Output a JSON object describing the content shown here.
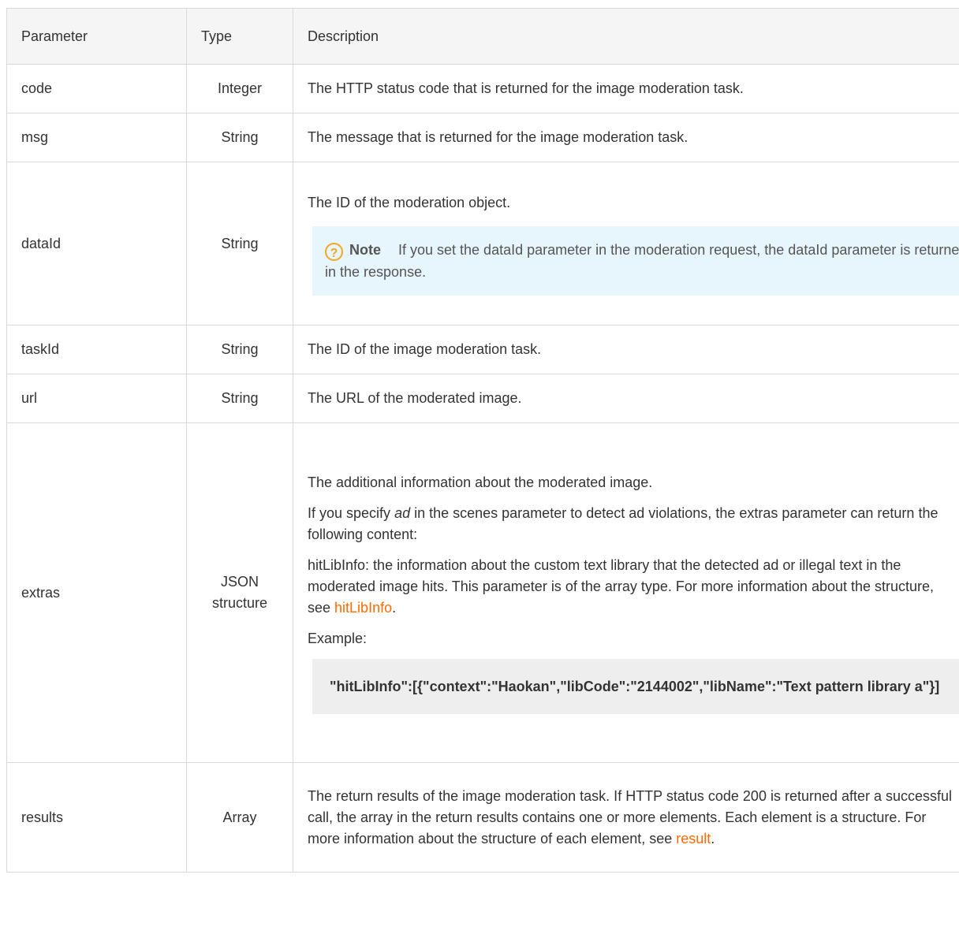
{
  "headers": [
    "Parameter",
    "Type",
    "Description"
  ],
  "rows": [
    {
      "name": "code",
      "type": "Integer",
      "desc": "The HTTP status code that is returned for the image moderation task."
    },
    {
      "name": "msg",
      "type": "String",
      "desc": "The message that is returned for the image moderation task."
    },
    {
      "name": "dataId",
      "type": "String",
      "desc": "The ID of the moderation object.",
      "note_title": "Note",
      "note_text": "If you set the dataId parameter in the moderation request, the dataId parameter is returned in the response."
    },
    {
      "name": "taskId",
      "type": "String",
      "desc": "The ID of the image moderation task."
    },
    {
      "name": "url",
      "type": "String",
      "desc": "The URL of the moderated image."
    },
    {
      "name": "extras",
      "type": "JSON structure",
      "p1": "The additional information about the moderated image.",
      "p2a": "If you specify ",
      "p2em": "ad",
      "p2b": " in the scenes parameter to detect ad violations, the extras parameter can return the following content:",
      "p3a": "hitLibInfo: the information about the custom text library that the detected ad or illegal text in the moderated image hits. This parameter is of the array type. For more information about the structure, see ",
      "p3link": "hitLibInfo",
      "p3b": ".",
      "p4": "Example:",
      "code": "\"hitLibInfo\":[{\"context\":\"Haokan\",\"libCode\":\"2144002\",\"libName\":\"Text pattern library a\"}]"
    },
    {
      "name": "results",
      "type": "Array",
      "desc_a": "The return results of the image moderation task. If HTTP status code 200 is returned after a successful call, the array in the return results contains one or more elements. Each element is a structure. For more information about the structure of each element, see ",
      "desc_link": "result",
      "desc_b": "."
    }
  ]
}
